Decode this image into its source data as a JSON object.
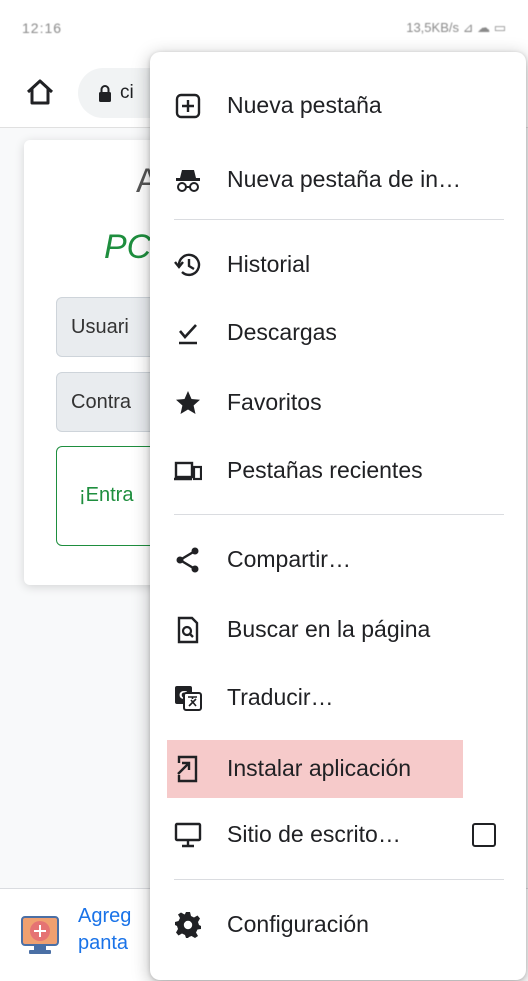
{
  "status_bar": {
    "time": "12:16",
    "indicators": "13,5KB/s ⊿ ☁ ▭"
  },
  "toolbar": {
    "url_text": "ci"
  },
  "page": {
    "title": "Al",
    "subtitle": "PC",
    "username_placeholder": "Usuari",
    "password_placeholder": "Contra",
    "enter_button": "¡Entra"
  },
  "banner": {
    "line1": "Agreg",
    "line2": "panta"
  },
  "menu": {
    "items": [
      {
        "label": "Nueva pestaña",
        "icon": "new-tab-icon"
      },
      {
        "label": "Nueva pestaña de in…",
        "icon": "incognito-icon"
      },
      {
        "label": "Historial",
        "icon": "history-icon"
      },
      {
        "label": "Descargas",
        "icon": "download-icon"
      },
      {
        "label": "Favoritos",
        "icon": "star-icon"
      },
      {
        "label": "Pestañas recientes",
        "icon": "recent-tabs-icon"
      },
      {
        "label": "Compartir…",
        "icon": "share-icon"
      },
      {
        "label": "Buscar en la página",
        "icon": "find-in-page-icon"
      },
      {
        "label": "Traducir…",
        "icon": "translate-icon"
      },
      {
        "label": "Instalar aplicación",
        "icon": "install-app-icon",
        "highlighted": true
      },
      {
        "label": "Sitio de escrito…",
        "icon": "desktop-icon",
        "checked": false
      },
      {
        "label": "Configuración",
        "icon": "gear-icon"
      }
    ]
  },
  "colors": {
    "highlight": "#f6caca",
    "brand_green": "#1e8e3e",
    "link_blue": "#1a73e8"
  }
}
